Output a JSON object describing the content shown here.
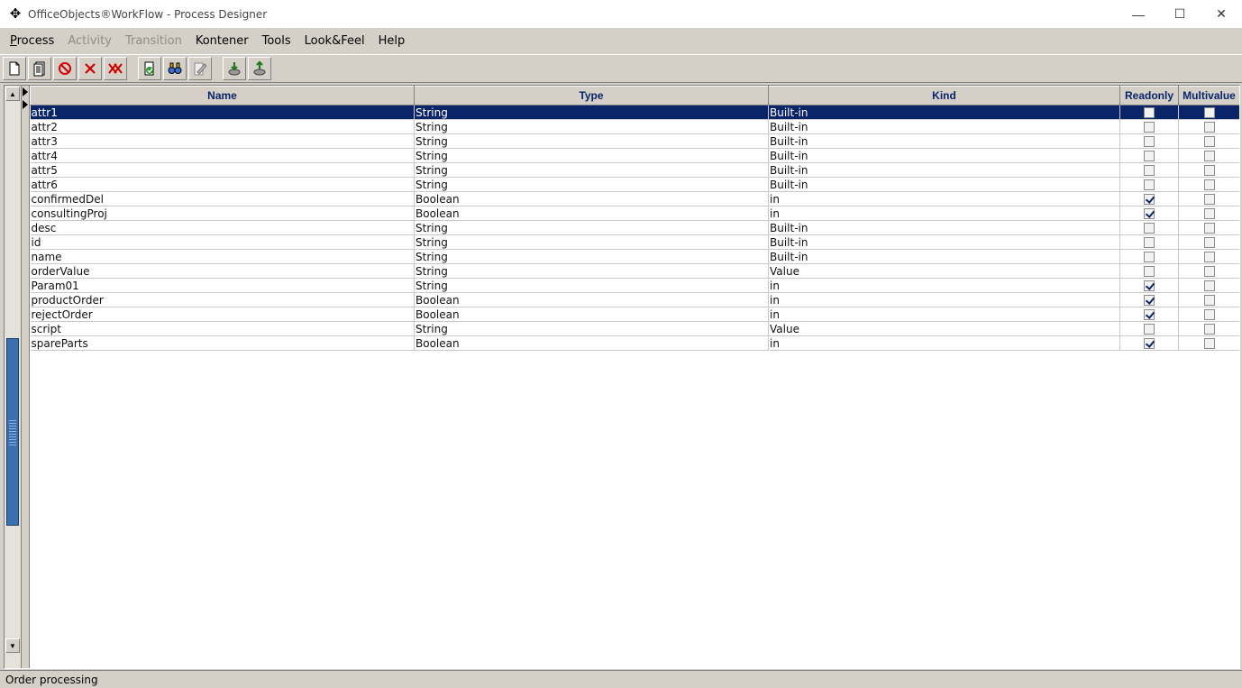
{
  "window": {
    "app_icon": "move-cross-icon",
    "title": "OfficeObjects®WorkFlow - Process Designer",
    "controls": {
      "minimize": "—",
      "maximize": "☐",
      "close": "✕"
    }
  },
  "menu": {
    "items": [
      {
        "label": "Process",
        "enabled": true
      },
      {
        "label": "Activity",
        "enabled": false
      },
      {
        "label": "Transition",
        "enabled": false
      },
      {
        "label": "Kontener",
        "enabled": true
      },
      {
        "label": "Tools",
        "enabled": true
      },
      {
        "label": "Look&Feel",
        "enabled": true
      },
      {
        "label": "Help",
        "enabled": true
      }
    ]
  },
  "toolbar": {
    "buttons": [
      "new-document-icon",
      "open-document-icon",
      "stop-icon",
      "delete-icon",
      "delete-all-icon",
      "validate-icon",
      "find-icon",
      "edit-properties-icon",
      "import-icon",
      "export-icon"
    ]
  },
  "grid": {
    "columns": [
      "Name",
      "Type",
      "Kind",
      "Readonly",
      "Multivalue"
    ],
    "rows": [
      {
        "name": "attr1",
        "type": "String",
        "kind": "Built-in",
        "readonly": false,
        "multivalue": false,
        "selected": true
      },
      {
        "name": "attr2",
        "type": "String",
        "kind": "Built-in",
        "readonly": false,
        "multivalue": false
      },
      {
        "name": "attr3",
        "type": "String",
        "kind": "Built-in",
        "readonly": false,
        "multivalue": false
      },
      {
        "name": "attr4",
        "type": "String",
        "kind": "Built-in",
        "readonly": false,
        "multivalue": false
      },
      {
        "name": "attr5",
        "type": "String",
        "kind": "Built-in",
        "readonly": false,
        "multivalue": false
      },
      {
        "name": "attr6",
        "type": "String",
        "kind": "Built-in",
        "readonly": false,
        "multivalue": false
      },
      {
        "name": "confirmedDel",
        "type": "Boolean",
        "kind": "in",
        "readonly": true,
        "multivalue": false
      },
      {
        "name": "consultingProj",
        "type": "Boolean",
        "kind": "in",
        "readonly": true,
        "multivalue": false
      },
      {
        "name": "desc",
        "type": "String",
        "kind": "Built-in",
        "readonly": false,
        "multivalue": false
      },
      {
        "name": "id",
        "type": "String",
        "kind": "Built-in",
        "readonly": false,
        "multivalue": false
      },
      {
        "name": "name",
        "type": "String",
        "kind": "Built-in",
        "readonly": false,
        "multivalue": false
      },
      {
        "name": "orderValue",
        "type": "String",
        "kind": "Value",
        "readonly": false,
        "multivalue": false
      },
      {
        "name": "Param01",
        "type": "String",
        "kind": "in",
        "readonly": true,
        "multivalue": false
      },
      {
        "name": "productOrder",
        "type": "Boolean",
        "kind": "in",
        "readonly": true,
        "multivalue": false
      },
      {
        "name": "rejectOrder",
        "type": "Boolean",
        "kind": "in",
        "readonly": true,
        "multivalue": false
      },
      {
        "name": "script",
        "type": "String",
        "kind": "Value",
        "readonly": false,
        "multivalue": false
      },
      {
        "name": "spareParts",
        "type": "Boolean",
        "kind": "in",
        "readonly": true,
        "multivalue": false
      }
    ]
  },
  "status": {
    "text": "Order processing"
  },
  "colors": {
    "selection": "#0a246a",
    "header_text": "#0a246a",
    "chrome": "#d4d0c8",
    "scroll_thumb": "#3a6fb0"
  }
}
